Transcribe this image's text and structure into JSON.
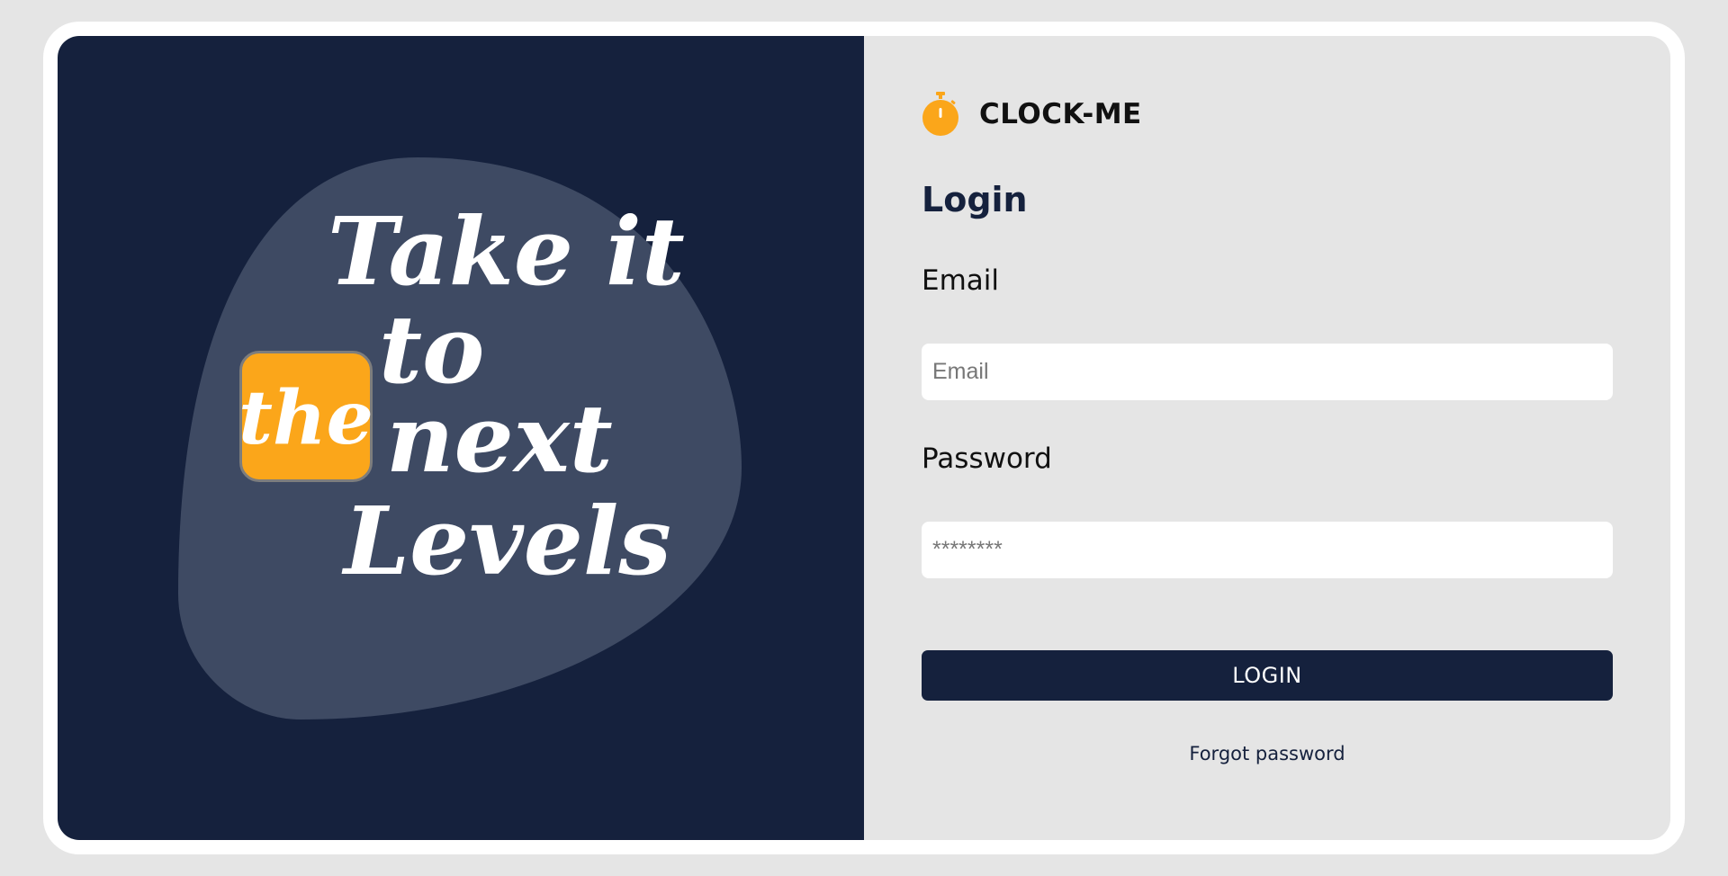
{
  "hero": {
    "lines": [
      "Take it",
      "to",
      "next",
      "Levels"
    ],
    "highlight": "the",
    "colors": {
      "panel": "#15213d",
      "blob": "#3e4a63",
      "highlight": "#fba61a"
    }
  },
  "brand": {
    "name": "CLOCK-ME",
    "icon": "stopwatch-icon",
    "icon_color": "#fba61a"
  },
  "login": {
    "title": "Login",
    "email_label": "Email",
    "email_placeholder": "Email",
    "password_label": "Password",
    "password_placeholder": "********",
    "button_label": "LOGIN",
    "forgot_password": "Forgot password"
  }
}
